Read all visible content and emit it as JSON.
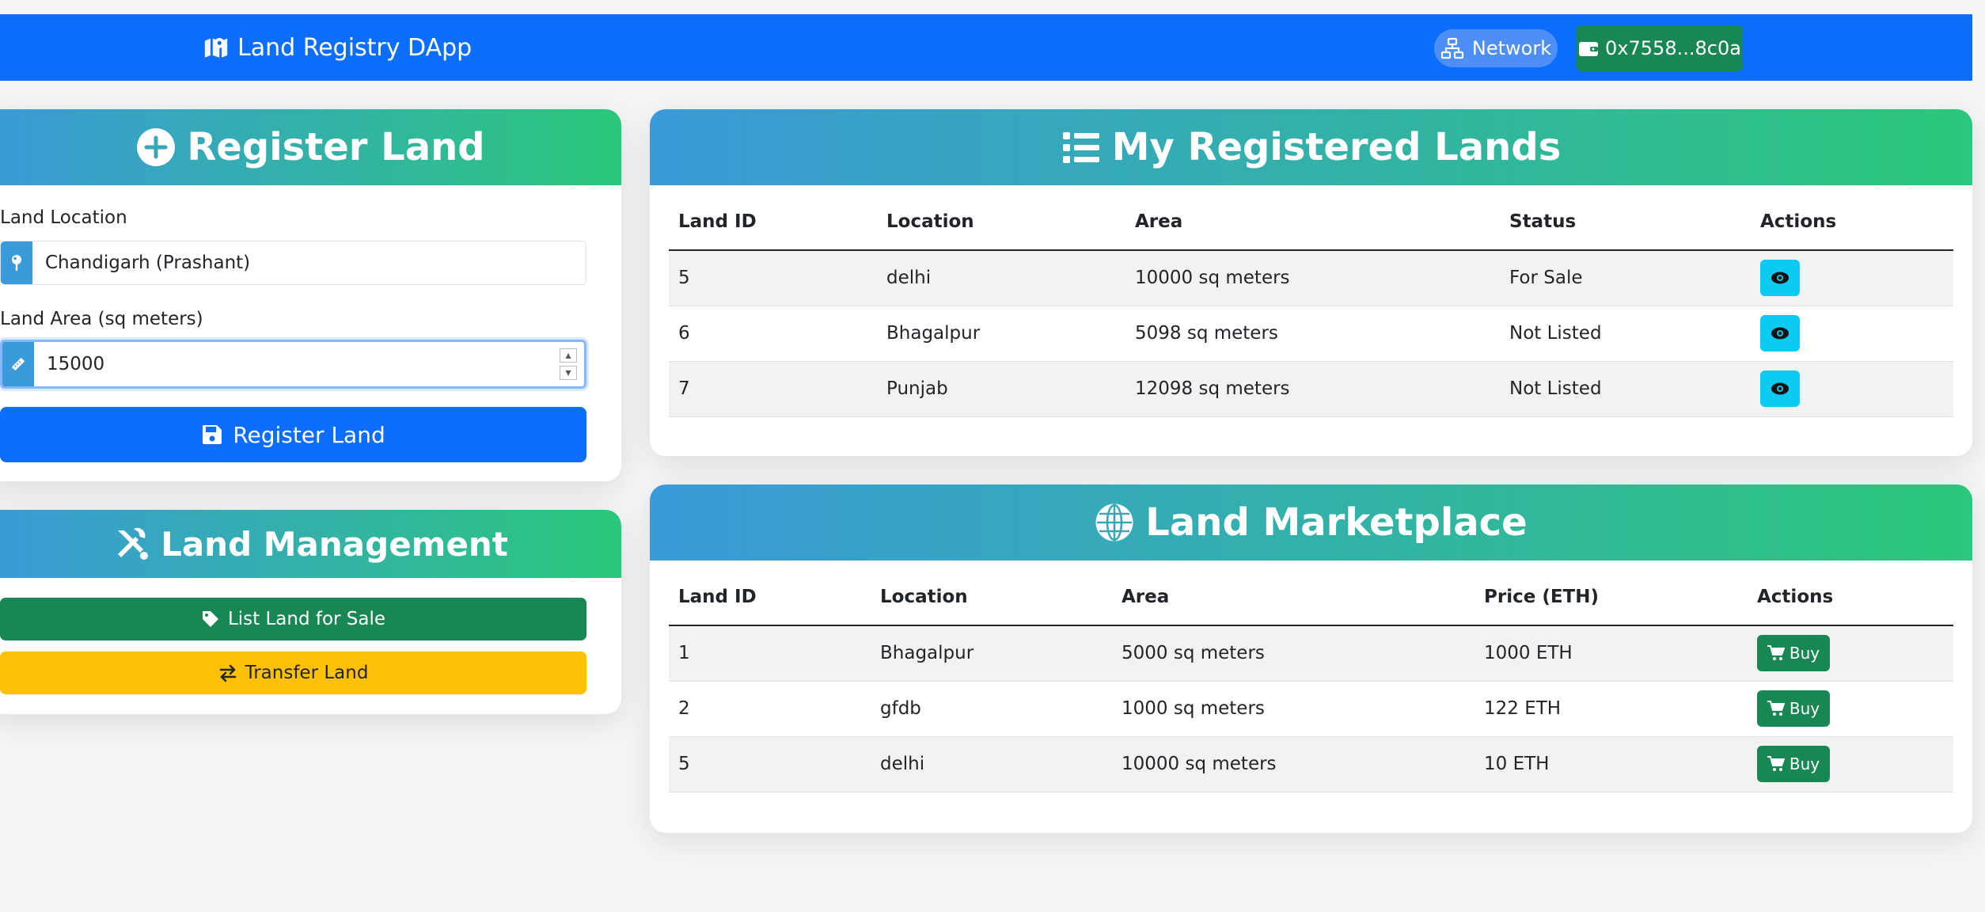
{
  "navbar": {
    "brand_icon": "map-location-icon",
    "brand": "Land Registry DApp",
    "network_icon": "network-icon",
    "network_label": "Network",
    "wallet_icon": "wallet-icon",
    "wallet_address": "0x7558...8c0a",
    "colors": {
      "navbar": "#0d6efd",
      "wallet": "#198754"
    }
  },
  "register": {
    "title": "Register Land",
    "title_icon": "plus-circle-icon",
    "location_label": "Land Location",
    "location_icon": "map-pin-icon",
    "location_value": "Chandigarh (Prashant)",
    "area_label": "Land Area (sq meters)",
    "area_icon": "ruler-icon",
    "area_value": "15000",
    "submit_icon": "save-icon",
    "submit_label": "Register Land"
  },
  "management": {
    "title": "Land Management",
    "title_icon": "tools-icon",
    "list_icon": "tag-icon",
    "list_label": "List Land for Sale",
    "transfer_icon": "exchange-icon",
    "transfer_label": "Transfer Land"
  },
  "my_lands": {
    "title": "My Registered Lands",
    "title_icon": "list-icon",
    "columns": [
      "Land ID",
      "Location",
      "Area",
      "Status",
      "Actions"
    ],
    "rows": [
      {
        "id": "5",
        "location": "delhi",
        "area": "10000 sq meters",
        "status": "For Sale",
        "action_icon": "eye-icon"
      },
      {
        "id": "6",
        "location": "Bhagalpur",
        "area": "5098 sq meters",
        "status": "Not Listed",
        "action_icon": "eye-icon"
      },
      {
        "id": "7",
        "location": "Punjab",
        "area": "12098 sq meters",
        "status": "Not Listed",
        "action_icon": "eye-icon"
      }
    ]
  },
  "marketplace": {
    "title": "Land Marketplace",
    "title_icon": "globe-icon",
    "columns": [
      "Land ID",
      "Location",
      "Area",
      "Price (ETH)",
      "Actions"
    ],
    "buy_icon": "cart-icon",
    "buy_label": "Buy",
    "rows": [
      {
        "id": "1",
        "location": "Bhagalpur",
        "area": "5000 sq meters",
        "price": "1000 ETH"
      },
      {
        "id": "2",
        "location": "gfdb",
        "area": "1000 sq meters",
        "price": "122 ETH"
      },
      {
        "id": "5",
        "location": "delhi",
        "area": "10000 sq meters",
        "price": "10 ETH"
      }
    ]
  }
}
